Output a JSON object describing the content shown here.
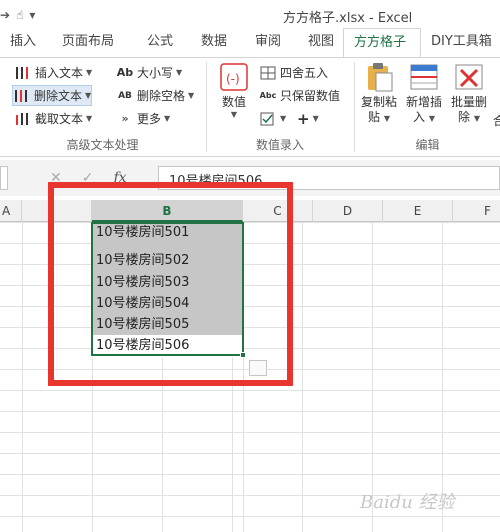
{
  "title_bar": {
    "window_title": "方方格子.xlsx - Excel",
    "qat_redo": "➔",
    "qat_touch": "☝",
    "qat_more": "▾"
  },
  "tabs": [
    {
      "label": "插入"
    },
    {
      "label": "页面布局"
    },
    {
      "label": "公式"
    },
    {
      "label": "数据"
    },
    {
      "label": "审阅"
    },
    {
      "label": "视图"
    },
    {
      "label": "方方格子",
      "active": true
    },
    {
      "label": "DIY工具箱"
    }
  ],
  "ribbon": {
    "text_group": {
      "label": "高级文本处理",
      "insert_text": "插入文本",
      "delete_text": "删除文本",
      "extract_text": "截取文本",
      "case": "大小写",
      "delete_spaces": "删除空格",
      "more": "更多",
      "case_icon_text": "Ab",
      "spaces_icon_text": "AB"
    },
    "number_group": {
      "label": "数值录入",
      "value_btn": "数值",
      "round": "四舍五入",
      "keep_value": "只保留数值",
      "plus": "+",
      "keep_icon_text": "Abc"
    },
    "edit_group": {
      "label": "编辑",
      "copy_paste_1": "复制粘",
      "copy_paste_2": "贴",
      "new_insert_1": "新增插",
      "new_insert_2": "入",
      "batch_delete_1": "批量删",
      "batch_delete_2": "除",
      "partial_label": "合"
    }
  },
  "formula_bar": {
    "fx": "fx",
    "cancel": "✕",
    "confirm": "✓",
    "value": "10号楼房间506"
  },
  "grid": {
    "columns": [
      "A",
      "B",
      "C",
      "D",
      "E",
      "F"
    ],
    "selected_column": "B",
    "cells_b": [
      "10号楼房间501",
      "10号楼房间502",
      "10号楼房间503",
      "10号楼房间504",
      "10号楼房间505",
      "10号楼房间506"
    ]
  },
  "colors": {
    "accent": "#217346",
    "annotation": "#e8352e",
    "selection_fill": "#c6c6c6"
  },
  "watermark": "Baidu 经验"
}
